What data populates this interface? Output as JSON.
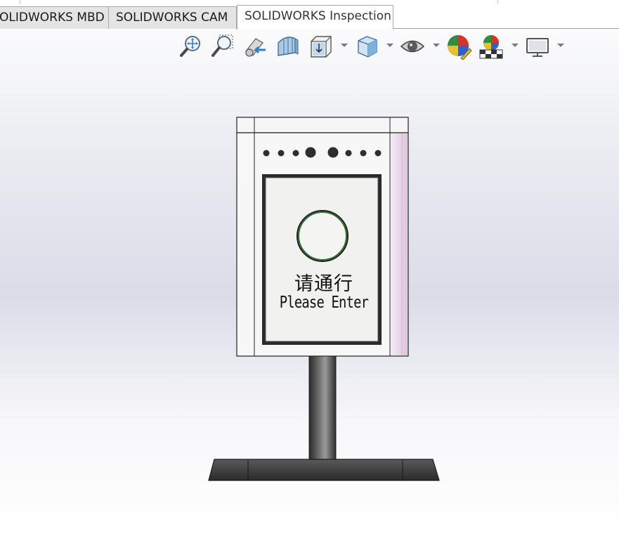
{
  "tabs": [
    {
      "label": "OLIDWORKS MBD",
      "active": false
    },
    {
      "label": "SOLIDWORKS CAM",
      "active": false
    },
    {
      "label": "SOLIDWORKS Inspection",
      "active": true
    }
  ],
  "toolbar": {
    "tools": [
      {
        "icon": "zoom-to-fit-icon",
        "has_dropdown": false
      },
      {
        "icon": "zoom-to-area-icon",
        "has_dropdown": false
      },
      {
        "icon": "previous-view-icon",
        "has_dropdown": false
      },
      {
        "icon": "section-view-icon",
        "has_dropdown": false
      },
      {
        "icon": "view-orientation-icon",
        "has_dropdown": true
      },
      {
        "icon": "display-style-icon",
        "has_dropdown": true
      },
      {
        "icon": "hide-show-items-icon",
        "has_dropdown": true
      },
      {
        "icon": "edit-appearance-icon",
        "has_dropdown": false
      },
      {
        "icon": "apply-scene-icon",
        "has_dropdown": true
      },
      {
        "icon": "view-settings-icon",
        "has_dropdown": true
      }
    ]
  },
  "model": {
    "screen_text_cn": "请通行",
    "screen_text_en": "Please Enter",
    "colors": {
      "frame": "#f4f4f4",
      "outline": "#222222",
      "ring": "#2f6b2f",
      "side_tint": "#ead8ec",
      "pole": "#4a4a4a",
      "base": "#3a3a3a"
    }
  }
}
